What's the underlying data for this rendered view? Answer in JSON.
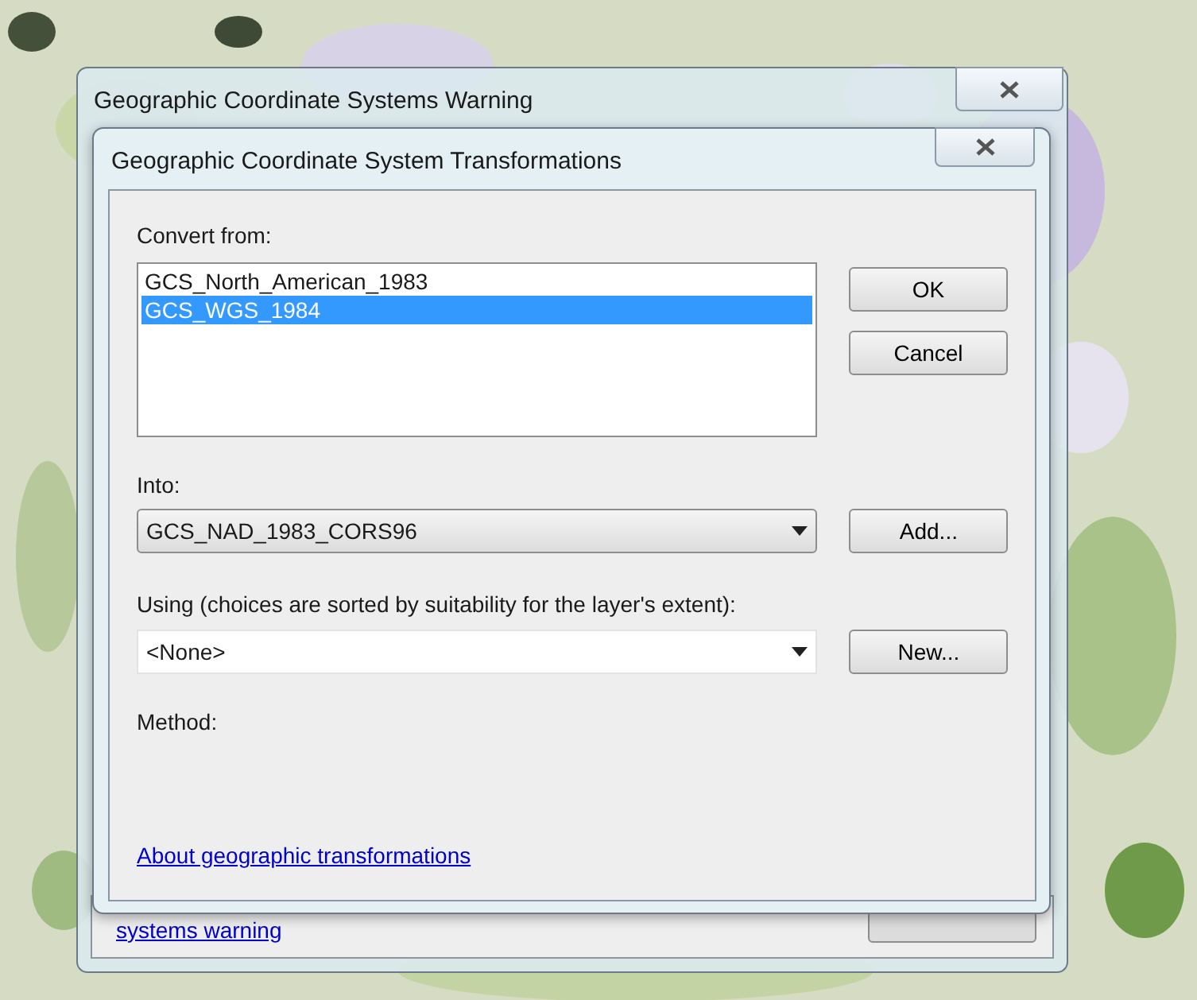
{
  "back_window": {
    "title": "Geographic Coordinate Systems Warning",
    "link": "systems warning"
  },
  "dialog": {
    "title": "Geographic Coordinate System Transformations",
    "convert_from": {
      "label": "Convert from:",
      "items": [
        {
          "text": "GCS_North_American_1983",
          "selected": false
        },
        {
          "text": "GCS_WGS_1984",
          "selected": true
        }
      ]
    },
    "into": {
      "label": "Into:",
      "value": "GCS_NAD_1983_CORS96"
    },
    "using": {
      "label": "Using (choices are sorted by suitability for the layer's extent):",
      "value": "<None>"
    },
    "method": {
      "label": "Method:"
    },
    "buttons": [
      "OK",
      "Cancel",
      "Add...",
      "New..."
    ],
    "link": "About geographic transformations"
  }
}
